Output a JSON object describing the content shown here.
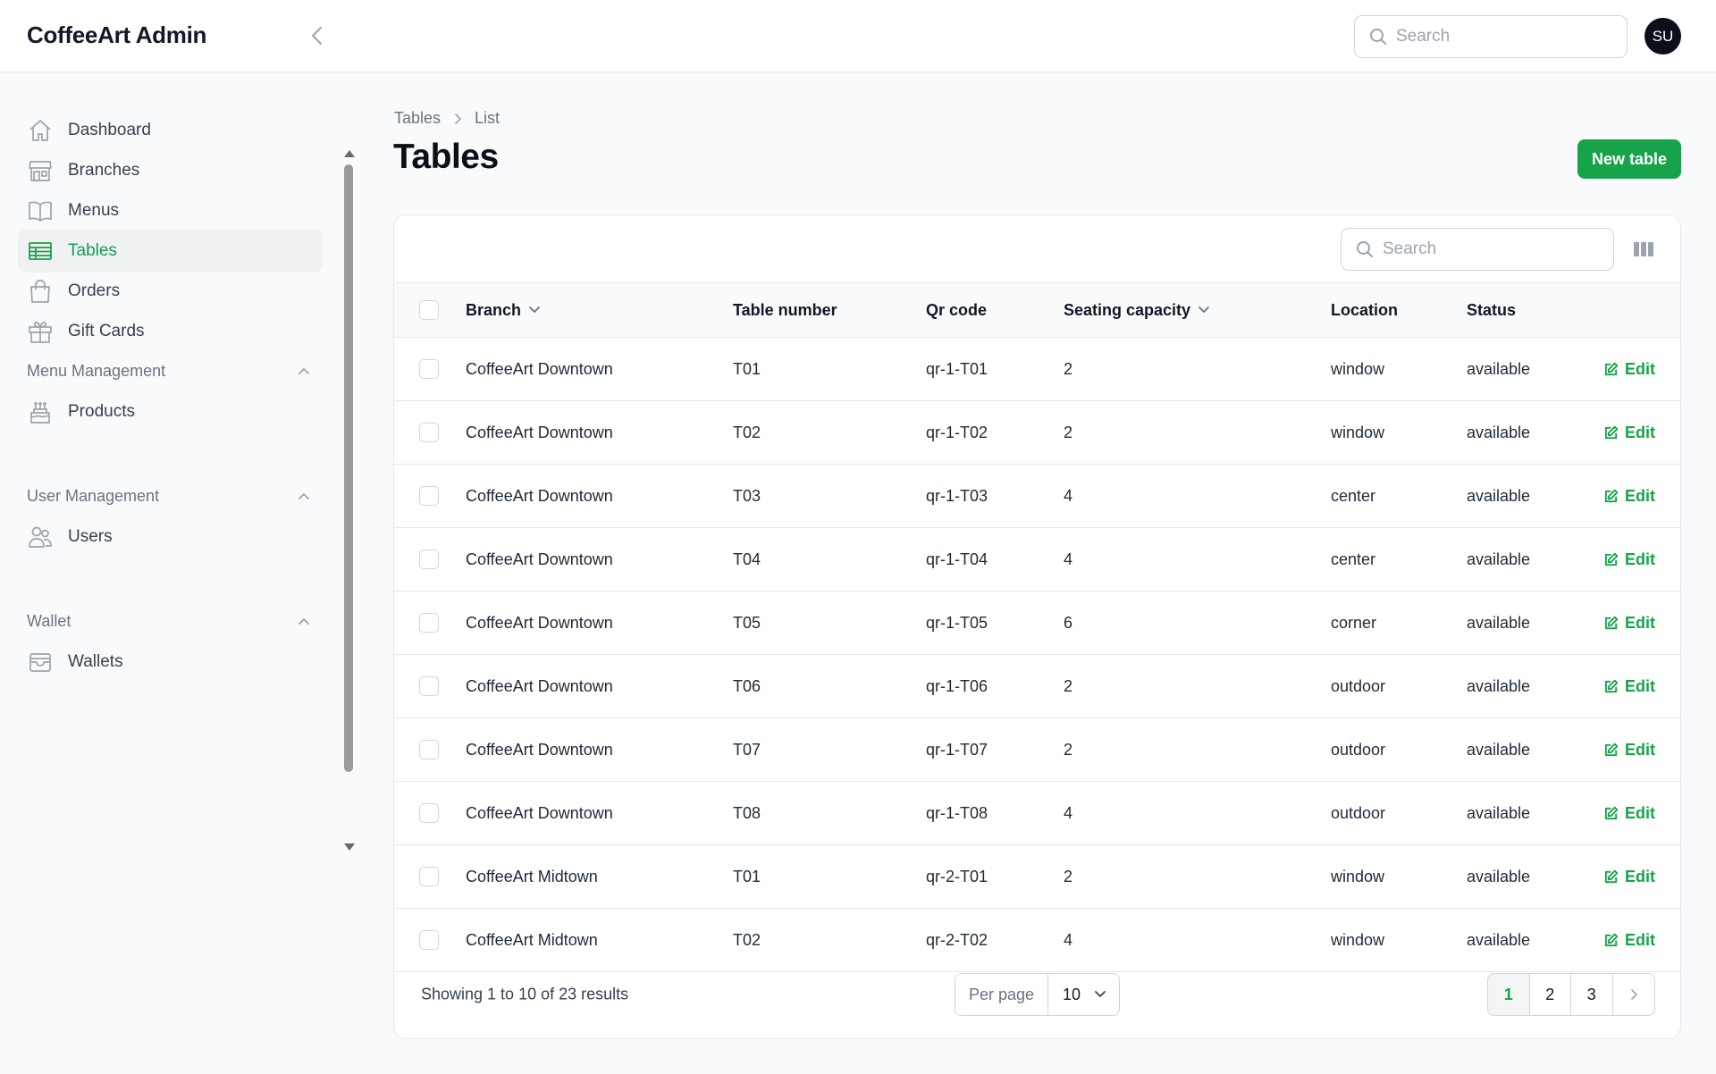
{
  "app": {
    "title": "CoffeeArt Admin",
    "search_placeholder": "Search",
    "user_initials": "SU"
  },
  "sidebar": {
    "items": [
      {
        "label": "Dashboard",
        "icon": "home-icon"
      },
      {
        "label": "Branches",
        "icon": "storefront-icon"
      },
      {
        "label": "Menus",
        "icon": "book-open-icon"
      },
      {
        "label": "Tables",
        "icon": "table-icon",
        "active": true
      },
      {
        "label": "Orders",
        "icon": "shopping-bag-icon"
      },
      {
        "label": "Gift Cards",
        "icon": "gift-icon"
      }
    ],
    "groups": [
      {
        "label": "Menu Management",
        "items": [
          {
            "label": "Products",
            "icon": "cake-icon"
          }
        ]
      },
      {
        "label": "User Management",
        "items": [
          {
            "label": "Users",
            "icon": "users-icon"
          }
        ]
      },
      {
        "label": "Wallet",
        "items": [
          {
            "label": "Wallets",
            "icon": "wallet-icon"
          }
        ]
      }
    ]
  },
  "breadcrumb": [
    "Tables",
    "List"
  ],
  "page": {
    "title": "Tables",
    "new_button": "New table"
  },
  "table": {
    "search_placeholder": "Search",
    "columns": [
      "Branch",
      "Table number",
      "Qr code",
      "Seating capacity",
      "Location",
      "Status"
    ],
    "edit_label": "Edit",
    "rows": [
      [
        "CoffeeArt Downtown",
        "T01",
        "qr-1-T01",
        "2",
        "window",
        "available"
      ],
      [
        "CoffeeArt Downtown",
        "T02",
        "qr-1-T02",
        "2",
        "window",
        "available"
      ],
      [
        "CoffeeArt Downtown",
        "T03",
        "qr-1-T03",
        "4",
        "center",
        "available"
      ],
      [
        "CoffeeArt Downtown",
        "T04",
        "qr-1-T04",
        "4",
        "center",
        "available"
      ],
      [
        "CoffeeArt Downtown",
        "T05",
        "qr-1-T05",
        "6",
        "corner",
        "available"
      ],
      [
        "CoffeeArt Downtown",
        "T06",
        "qr-1-T06",
        "2",
        "outdoor",
        "available"
      ],
      [
        "CoffeeArt Downtown",
        "T07",
        "qr-1-T07",
        "2",
        "outdoor",
        "available"
      ],
      [
        "CoffeeArt Downtown",
        "T08",
        "qr-1-T08",
        "4",
        "outdoor",
        "available"
      ],
      [
        "CoffeeArt Midtown",
        "T01",
        "qr-2-T01",
        "2",
        "window",
        "available"
      ],
      [
        "CoffeeArt Midtown",
        "T02",
        "qr-2-T02",
        "4",
        "window",
        "available"
      ]
    ],
    "footer": {
      "summary": "Showing 1 to 10 of 23 results",
      "per_page_label": "Per page",
      "per_page_value": "10",
      "pages": [
        "1",
        "2",
        "3"
      ],
      "current_page": "1"
    }
  },
  "colors": {
    "accent": "#16a34a",
    "active_nav_bg": "#f0f1f3",
    "avatar_bg": "#0b0f19"
  }
}
